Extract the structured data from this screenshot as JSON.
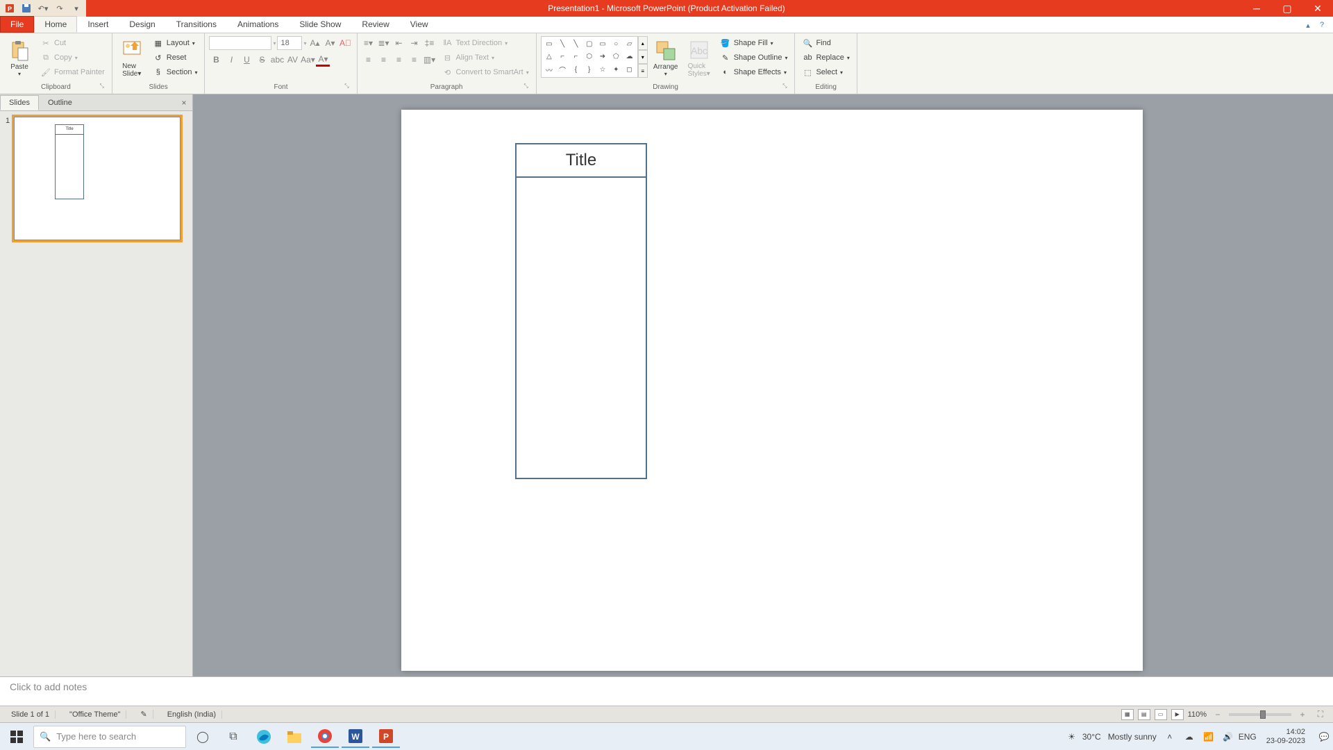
{
  "title": "Presentation1 - Microsoft PowerPoint (Product Activation Failed)",
  "tabs": {
    "file": "File",
    "home": "Home",
    "insert": "Insert",
    "design": "Design",
    "transitions": "Transitions",
    "animations": "Animations",
    "slideshow": "Slide Show",
    "review": "Review",
    "view": "View"
  },
  "ribbon": {
    "clipboard": {
      "label": "Clipboard",
      "paste": "Paste",
      "cut": "Cut",
      "copy": "Copy",
      "format_painter": "Format Painter"
    },
    "slides": {
      "label": "Slides",
      "new_slide": "New\nSlide",
      "layout": "Layout",
      "reset": "Reset",
      "section": "Section"
    },
    "font": {
      "label": "Font",
      "size": "18"
    },
    "paragraph": {
      "label": "Paragraph",
      "text_direction": "Text Direction",
      "align_text": "Align Text",
      "convert": "Convert to SmartArt"
    },
    "drawing": {
      "label": "Drawing",
      "arrange": "Arrange",
      "quick_styles": "Quick\nStyles",
      "shape_fill": "Shape Fill",
      "shape_outline": "Shape Outline",
      "shape_effects": "Shape Effects"
    },
    "editing": {
      "label": "Editing",
      "find": "Find",
      "replace": "Replace",
      "select": "Select"
    }
  },
  "panel": {
    "tab_slides": "Slides",
    "tab_outline": "Outline",
    "thumb_num": "1",
    "thumb_title": "Title"
  },
  "slide": {
    "title_text": "Title"
  },
  "notes": {
    "placeholder": "Click to add notes"
  },
  "status": {
    "slide": "Slide 1 of 1",
    "theme": "\"Office Theme\"",
    "lang": "English (India)",
    "zoom": "110%"
  },
  "taskbar": {
    "search_placeholder": "Type here to search",
    "weather_temp": "30°C",
    "weather_desc": "Mostly sunny",
    "time": "14:02",
    "date": "23-09-2023"
  }
}
